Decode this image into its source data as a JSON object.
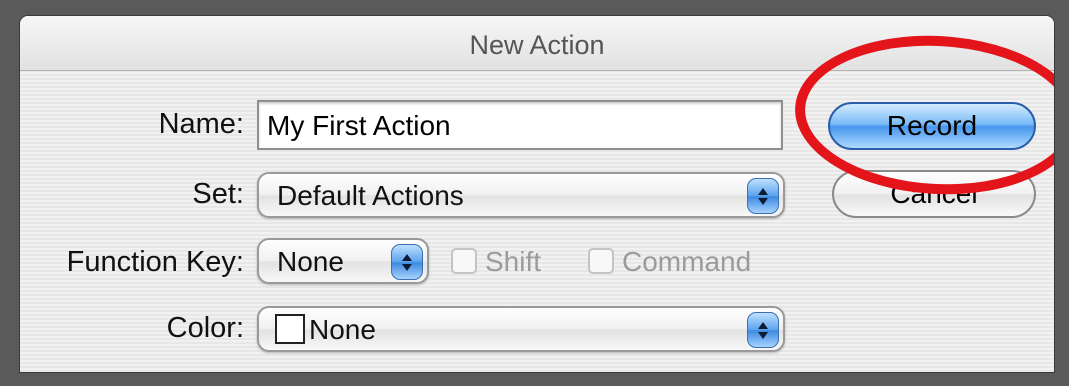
{
  "window": {
    "title": "New Action"
  },
  "form": {
    "name_label": "Name:",
    "name_value": "My First Action",
    "set_label": "Set:",
    "set_value": "Default Actions",
    "function_key_label": "Function Key:",
    "function_key_value": "None",
    "shift_label": "Shift",
    "shift_checked": false,
    "command_label": "Command",
    "command_checked": false,
    "color_label": "Color:",
    "color_value": "None"
  },
  "buttons": {
    "record_label": "Record",
    "cancel_label": "Cancel"
  },
  "annotation": {
    "highlight_color": "#e3141a",
    "shape": "ellipse-around-record-button"
  },
  "icons": {
    "popup_arrows": "updown-arrows-icon",
    "color_swatch": "color-swatch-icon"
  }
}
